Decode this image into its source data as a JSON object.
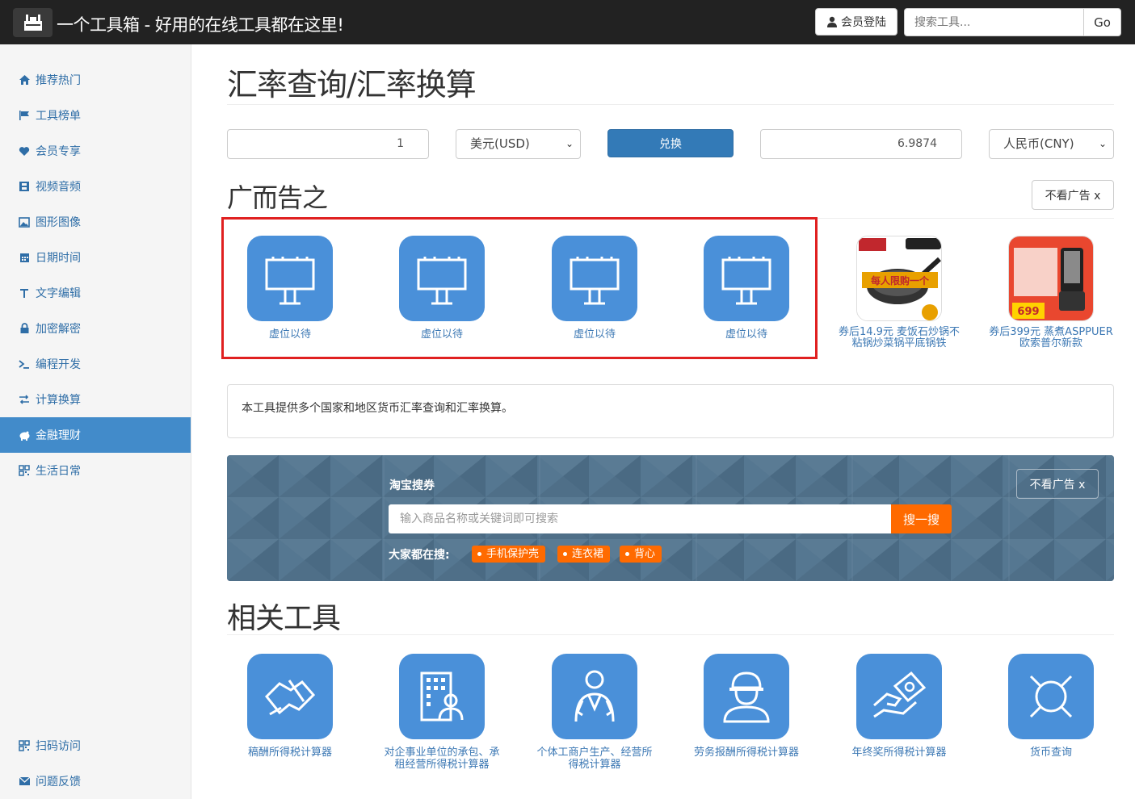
{
  "navbar": {
    "title": "一个工具箱 - 好用的在线工具都在这里!",
    "login_label": "会员登陆",
    "search_placeholder": "搜索工具...",
    "go_label": "Go"
  },
  "sidebar": {
    "items": [
      {
        "label": "推荐热门",
        "icon": "home-icon"
      },
      {
        "label": "工具榜单",
        "icon": "flag-icon"
      },
      {
        "label": "会员专享",
        "icon": "heart-icon"
      },
      {
        "label": "视频音频",
        "icon": "film-icon"
      },
      {
        "label": "图形图像",
        "icon": "picture-icon"
      },
      {
        "label": "日期时间",
        "icon": "calendar-icon"
      },
      {
        "label": "文字编辑",
        "icon": "text-icon"
      },
      {
        "label": "加密解密",
        "icon": "lock-icon"
      },
      {
        "label": "编程开发",
        "icon": "terminal-icon"
      },
      {
        "label": "计算换算",
        "icon": "swap-icon"
      },
      {
        "label": "金融理财",
        "icon": "piggy-bank-icon"
      },
      {
        "label": "生活日常",
        "icon": "qrcode-icon"
      }
    ],
    "bottom_items": [
      {
        "label": "扫码访问",
        "icon": "qrcode-icon"
      },
      {
        "label": "问题反馈",
        "icon": "envelope-icon"
      }
    ]
  },
  "main": {
    "page_title": "汇率查询/汇率换算",
    "converter": {
      "amount": "1",
      "from_currency": "美元(USD)",
      "convert_label": "兑换",
      "result": "6.9874",
      "to_currency": "人民币(CNY)"
    },
    "ads": {
      "title": "广而告之",
      "hide_label": "不看广告 x",
      "placeholder_label": "虚位以待",
      "placeholders": [
        "虚位以待",
        "虚位以待",
        "虚位以待",
        "虚位以待"
      ],
      "products": [
        {
          "label_line1": "券后14.9元 麦饭石炒锅不",
          "label_line2": "粘锅炒菜锅平底锅铁",
          "badge": "每人限购一个"
        },
        {
          "label_line1": "券后399元 蒸煮ASPPUER",
          "label_line2": "欧索普尔新款",
          "badge": "699"
        }
      ]
    },
    "description": "本工具提供多个国家和地区货币汇率查询和汇率换算。",
    "taobao": {
      "label": "淘宝搜券",
      "search_placeholder": "输入商品名称或关键词即可搜索",
      "search_button": "搜一搜",
      "hot_label": "大家都在搜:",
      "tags": [
        "手机保护壳",
        "连衣裙",
        "背心"
      ],
      "hide_label": "不看广告 x"
    },
    "related": {
      "title": "相关工具",
      "tools": [
        {
          "line1": "稿酬所得税计算器",
          "line2": "",
          "icon": "handshake-icon"
        },
        {
          "line1": "对企事业单位的承包、承",
          "line2": "租经营所得税计算器",
          "icon": "building-icon"
        },
        {
          "line1": "个体工商户生产、经营所",
          "line2": "得税计算器",
          "icon": "doctor-icon"
        },
        {
          "line1": "劳务报酬所得税计算器",
          "line2": "",
          "icon": "worker-icon"
        },
        {
          "line1": "年终奖所得税计算器",
          "line2": "",
          "icon": "money-hand-icon"
        },
        {
          "line1": "货币查询",
          "line2": "",
          "icon": "currency-icon"
        }
      ]
    }
  }
}
